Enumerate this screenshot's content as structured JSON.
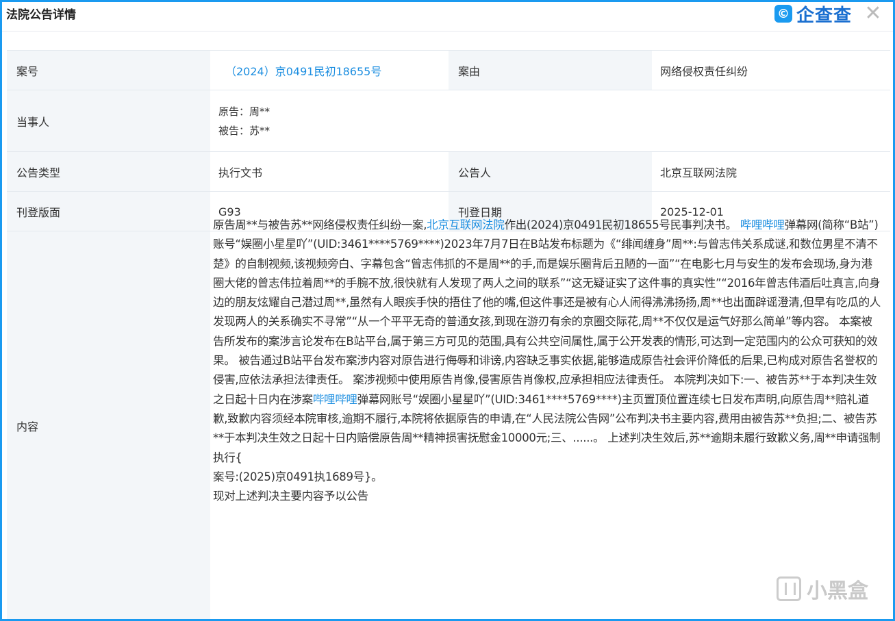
{
  "header": {
    "title": "法院公告详情",
    "brand_logo": "©",
    "brand_name": "企查查",
    "close_symbol": "✕"
  },
  "table": {
    "case_no_label": "案号",
    "case_no_value": "（2024）京0491民初18655号",
    "cause_label": "案由",
    "cause_value": "网络侵权责任纠纷",
    "parties_label": "当事人",
    "plaintiff": "原告：周**",
    "defendant": "被告：苏**",
    "notice_type_label": "公告类型",
    "notice_type_value": "执行文书",
    "announcer_label": "公告人",
    "announcer_value": "北京互联网法院",
    "page_label": "刊登版面",
    "page_value": "G93",
    "date_label": "刊登日期",
    "date_value": "2025-12-01",
    "content_label": "内容"
  },
  "content": {
    "p1_a": "原告周**与被告苏**网络侵权责任纠纷一案,",
    "p1_link": "北京互联网法院",
    "p1_b": "作出(2024)京0491民初18655号民事判决书。 ",
    "p1_link2": "哔哩哔哩",
    "p1_c": "弹幕网(简称“B站”)账号“娱圈小星星吖”(UID:3461****5769****)2023年7月7日在B站发布标题为《“绯闻缠身”周**:与曾志伟关系成谜,和数位男星不清不楚》的自制视频,该视频旁白、字幕包含“曾志伟抓的不是周**的手,而是娱乐圈背后丑陋的一面”“在电影七月与安生的发布会现场,身为港圈大佬的曾志伟拉着周**的手腕不放,很快就有人发现了两人之间的联系”“这无疑证实了这件事的真实性”“2016年曾志伟酒后吐真言,向身边的朋友炫耀自己潜过周**,虽然有人眼疾手快的捂住了他的嘴,但这件事还是被有心人闹得沸沸扬扬,周**也出面辟谣澄清,但早有吃瓜的人发现两人的关系确实不寻常”“从一个平平无奇的普通女孩,到现在游刃有余的京圈交际花,周**不仅仅是运气好那么简单”等内容。 本案被告所发布的案涉言论发布在B站平台,属于第三方可见的范围,具有公共空间属性,属于公开发表的情形,可达到一定范围内的公众可获知的效果。 被告通过B站平台发布案涉内容对原告进行侮辱和诽谤,内容缺乏事实依据,能够造成原告社会评价降低的后果,已构成对原告名誉权的侵害,应依法承担法律责任。 案涉视频中使用原告肖像,侵害原告肖像权,应承担相应法律责任。 本院判决如下:一、被告苏**于本判决生效之日起十日内在涉案",
    "p1_link3": "哔哩哔哩",
    "p1_d": "弹幕网账号“娱圈小星星吖”(UID:3461****5769****)主页置顶位置连续七日发布声明,向原告周**赔礼道歉,致歉内容须经本院审核,逾期不履行,本院将依据原告的申请,在“人民法院公告网”公布判决书主要内容,费用由被告苏**负担;二、被告苏**于本判决生效之日起十日内赔偿原告周**精神损害抚慰金10000元;三、......。 上述判决生效后,苏**逾期未履行致歉义务,周**申请强制执行{",
    "line_case": "案号:(2025)京0491执1689号}。",
    "line_end": "现对上述判决主要内容予以公告"
  },
  "watermark": {
    "text": "小黑盒"
  },
  "colors": {
    "accent": "#1a9af0",
    "link": "#1a8de0",
    "label_bg": "#f3f6f9"
  }
}
